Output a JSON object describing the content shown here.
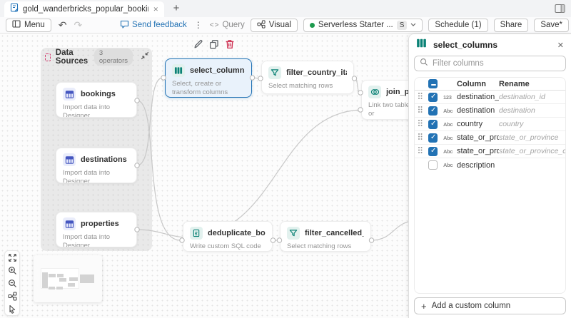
{
  "tab_bar": {
    "tab_title": "gold_wanderbricks_popular_bookings",
    "close_glyph": "✕",
    "new_tab_glyph": "+"
  },
  "toolbar": {
    "menu": "Menu",
    "undo_glyph": "↶",
    "redo_glyph": "↷",
    "send_feedback": "Send feedback",
    "kebab_glyph": "⋮",
    "query_icon": "<>",
    "query": "Query",
    "visual": "Visual",
    "warehouse_name": "Serverless Starter ...",
    "warehouse_size": "S",
    "schedule": "Schedule (1)",
    "share": "Share",
    "save": "Save*"
  },
  "canvas": {
    "group": {
      "title": "Data Sources",
      "badge": "3 operators"
    },
    "nodes": {
      "bookings": {
        "title": "bookings",
        "desc": "Import data into Designer"
      },
      "destinations": {
        "title": "destinations",
        "desc": "Import data into Designer"
      },
      "properties": {
        "title": "properties",
        "desc": "Import data into Designer"
      },
      "select_columns": {
        "title": "select_columns",
        "desc": "Select, create or transform columns"
      },
      "filter_country_italy": {
        "title": "filter_country_italy",
        "desc": "Select matching rows"
      },
      "join_properties": {
        "title": "join_prope",
        "desc": "Link two tables or"
      },
      "deduplicate_bookings": {
        "title": "deduplicate_bookings",
        "desc": "Write custom SQL code"
      },
      "filter_cancelled": {
        "title": "filter_cancelled_bookin...",
        "desc": "Select matching rows"
      }
    }
  },
  "panel": {
    "title": "select_columns",
    "close_glyph": "✕",
    "filter_placeholder": "Filter columns",
    "header_indeterminate": true,
    "col_header": "Column",
    "rename_header": "Rename",
    "rows": [
      {
        "name": "destination_id",
        "rename": "destination_id",
        "type": "123",
        "checked": true,
        "drag": true
      },
      {
        "name": "destination",
        "rename": "destination",
        "type": "Abc",
        "checked": true,
        "drag": true
      },
      {
        "name": "country",
        "rename": "country",
        "type": "Abc",
        "checked": true,
        "drag": true
      },
      {
        "name": "state_or_province",
        "rename": "state_or_province",
        "type": "Abc",
        "checked": true,
        "drag": true
      },
      {
        "name": "state_or_provinc...",
        "rename": "state_or_province_c...",
        "type": "Abc",
        "checked": true,
        "drag": true
      },
      {
        "name": "description",
        "rename": "",
        "type": "Abc",
        "checked": false,
        "drag": false
      }
    ],
    "add_button": "Add a custom column",
    "add_plus_glyph": "+"
  },
  "colors": {
    "accent_blue": "#2272b4",
    "teal": "#0b8276",
    "indigo": "#4456c0",
    "danger": "#ce2c4e",
    "green": "#1d9a4e"
  }
}
